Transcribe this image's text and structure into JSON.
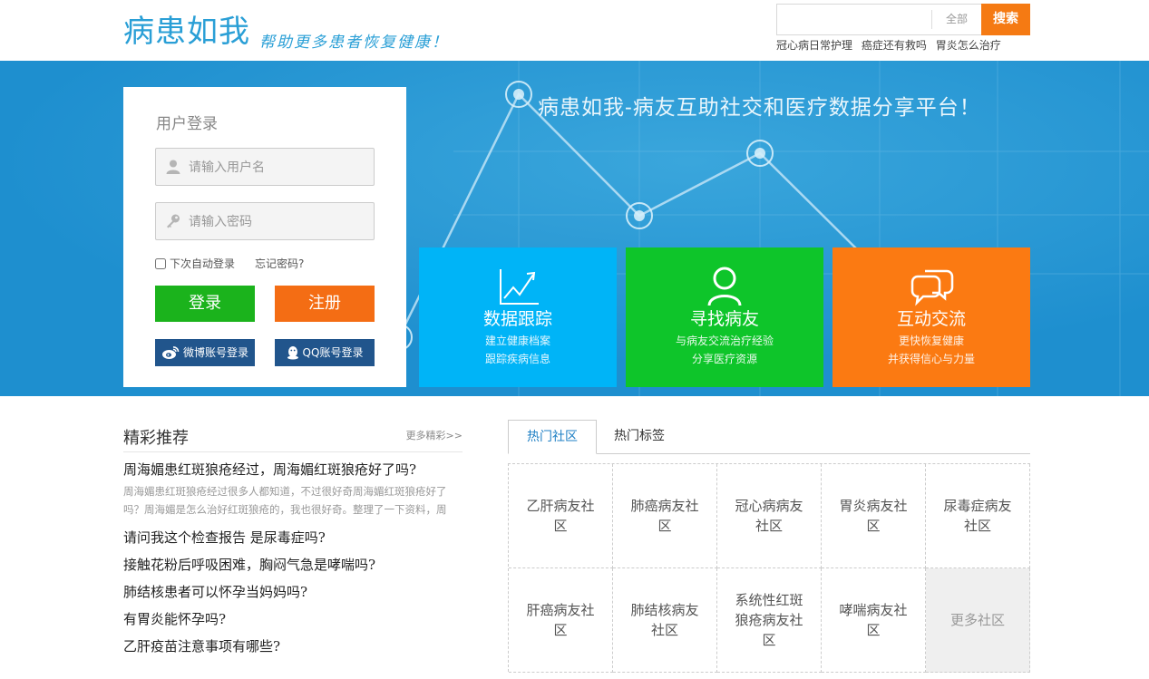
{
  "header": {
    "logo": "病患如我",
    "slogan": "帮助更多患者恢复健康！",
    "search": {
      "placeholder": "",
      "scope": "全部",
      "button": "搜索"
    },
    "hot_keywords": [
      "冠心病日常护理",
      "癌症还有救吗",
      "胃炎怎么治疗"
    ]
  },
  "banner": {
    "title": "病患如我-病友互助社交和医疗数据分享平台！",
    "login": {
      "title": "用户登录",
      "username_placeholder": "请输入用户名",
      "password_placeholder": "请输入密码",
      "remember": "下次自动登录",
      "forgot": "忘记密码?",
      "login_button": "登录",
      "register_button": "注册",
      "weibo_button": "微博账号登录",
      "qq_button": "QQ账号登录"
    },
    "features": [
      {
        "title": "数据跟踪",
        "line1": "建立健康档案",
        "line2": "跟踪疾病信息",
        "icon": "chart-icon",
        "color": "#00b4f7"
      },
      {
        "title": "寻找病友",
        "line1": "与病友交流治疗经验",
        "line2": "分享医疗资源",
        "icon": "person-icon",
        "color": "#0ec52a"
      },
      {
        "title": "互动交流",
        "line1": "更快恢复健康",
        "line2": "并获得信心与力量",
        "icon": "chat-bubbles-icon",
        "color": "#fb7a12"
      }
    ]
  },
  "recommend": {
    "title": "精彩推荐",
    "more": "更多精彩>>",
    "featured_title": "周海媚患红斑狼疮经过，周海媚红斑狼疮好了吗?",
    "featured_summary": "周海媚患红斑狼疮经过很多人都知道，不过很好奇周海媚红斑狼疮好了吗？周海媚是怎么治好红斑狼疮的，我也很好奇。整理了一下资料，周",
    "items": [
      "请问我这个检查报告 是尿毒症吗?",
      "接触花粉后呼吸困难，胸闷气急是哮喘吗?",
      "肺结核患者可以怀孕当妈妈吗?",
      "有胃炎能怀孕吗?",
      "乙肝疫苗注意事项有哪些?"
    ]
  },
  "community": {
    "tabs": [
      "热门社区",
      "热门标签"
    ],
    "cells": [
      "乙肝病友社区",
      "肺癌病友社区",
      "冠心病病友社区",
      "胃炎病友社区",
      "尿毒症病友社区",
      "肝癌病友社区",
      "肺结核病友社区",
      "系统性红斑狼疮病友社区",
      "哮喘病友社区",
      "更多社区"
    ]
  },
  "colors": {
    "brand_blue": "#1e8fcf",
    "search_orange": "#f57a13",
    "login_green": "#1bb31c",
    "register_orange": "#f46d14",
    "social_blue": "#21558c"
  }
}
